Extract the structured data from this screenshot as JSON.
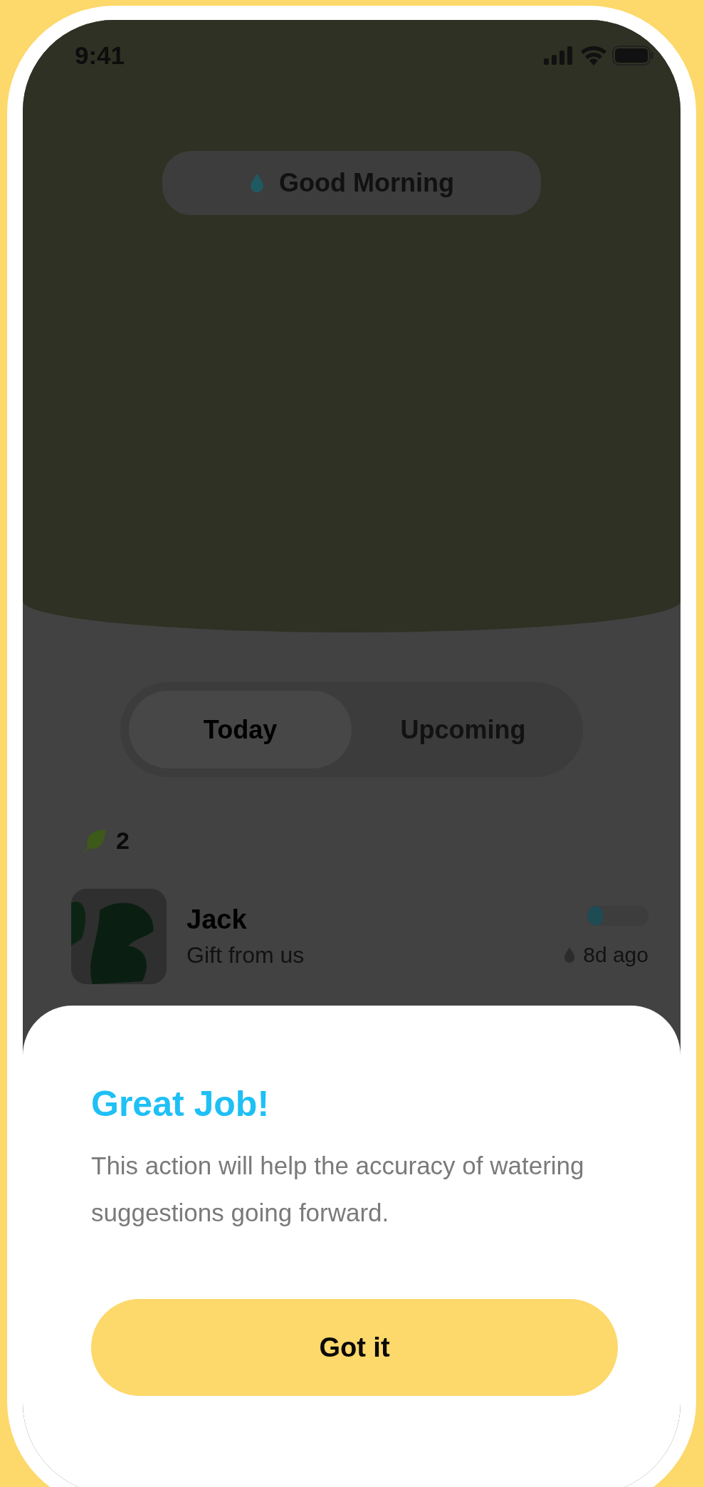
{
  "status_bar": {
    "time": "9:41"
  },
  "greeting": {
    "text": "Good Morning"
  },
  "tabs": [
    {
      "label": "Today",
      "selected": true
    },
    {
      "label": "Upcoming",
      "selected": false
    }
  ],
  "plant_count": "2",
  "plants": [
    {
      "name": "Jack",
      "subtitle": "Gift from us",
      "level": 0.25,
      "last_watered": "8d ago"
    }
  ],
  "sheet": {
    "title": "Great Job!",
    "message": "This action will help the accuracy of watering suggestions going forward.",
    "button": "Got it"
  }
}
